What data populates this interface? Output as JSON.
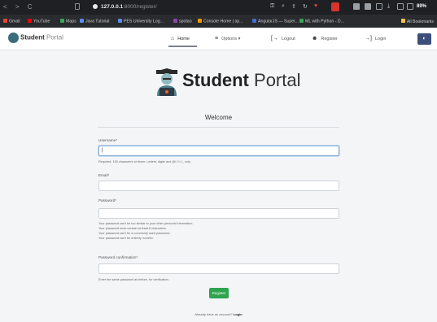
{
  "browser": {
    "url_host": "127.0.0.1",
    "url_path": ":8000/register/",
    "nav_glyphs": "< > C",
    "zoom_text": "89%",
    "bookmarks": [
      {
        "label": "Gmail",
        "color": "#ea4335"
      },
      {
        "label": "YouTube",
        "color": "#ff0000"
      },
      {
        "label": "Maps",
        "color": "#34a853"
      },
      {
        "label": "Java Tutorial",
        "color": "#5b8def"
      },
      {
        "label": "PES University Log...",
        "color": "#5b8def"
      },
      {
        "label": "spotao",
        "color": "#8e44ad"
      },
      {
        "label": "Console Home | ap...",
        "color": "#f29900"
      },
      {
        "label": "AngularJS — Super...",
        "color": "#3d6fd6"
      },
      {
        "label": "ML with Python - D...",
        "color": "#34a853"
      }
    ],
    "all_bookmarks": "All Bookmarks"
  },
  "navbar": {
    "brand_bold": "Student",
    "brand_light": "Portal",
    "items": [
      {
        "label": "Home",
        "icon": "home-icon",
        "glyph": "⌂"
      },
      {
        "label": "Options",
        "icon": "menu-icon",
        "glyph": "≡"
      },
      {
        "label": "Logout",
        "icon": "logout-icon",
        "glyph": "[→"
      },
      {
        "label": "Register",
        "icon": "user-plus-icon",
        "glyph": "☻"
      },
      {
        "label": "Login",
        "icon": "login-icon",
        "glyph": "→]"
      }
    ],
    "options_caret": "▾"
  },
  "hero": {
    "title_bold": "Student",
    "title_light": "Portal"
  },
  "page": {
    "heading": "Welcome"
  },
  "form": {
    "username_label": "Username*",
    "username_value": "|",
    "username_help": "Required. 150 characters or fewer. Letters, digits and @/./+/-/_ only.",
    "email_label": "Email*",
    "email_value": "",
    "password_label": "Password*",
    "password_value": "",
    "password_help": [
      "Your password can't be too similar to your other personal information.",
      "Your password must contain at least 8 characters.",
      "Your password can't be a commonly used password.",
      "Your password can't be entirely numeric."
    ],
    "confirm_label": "Password confirmation*",
    "confirm_value": "",
    "confirm_help": "Enter the same password as before, for verification.",
    "submit_label": "Register"
  },
  "footer": {
    "text": "Already have an account?",
    "link": "Login"
  },
  "colors": {
    "primary_button": "#2ea44f",
    "focus_border": "#7ea6d8"
  }
}
